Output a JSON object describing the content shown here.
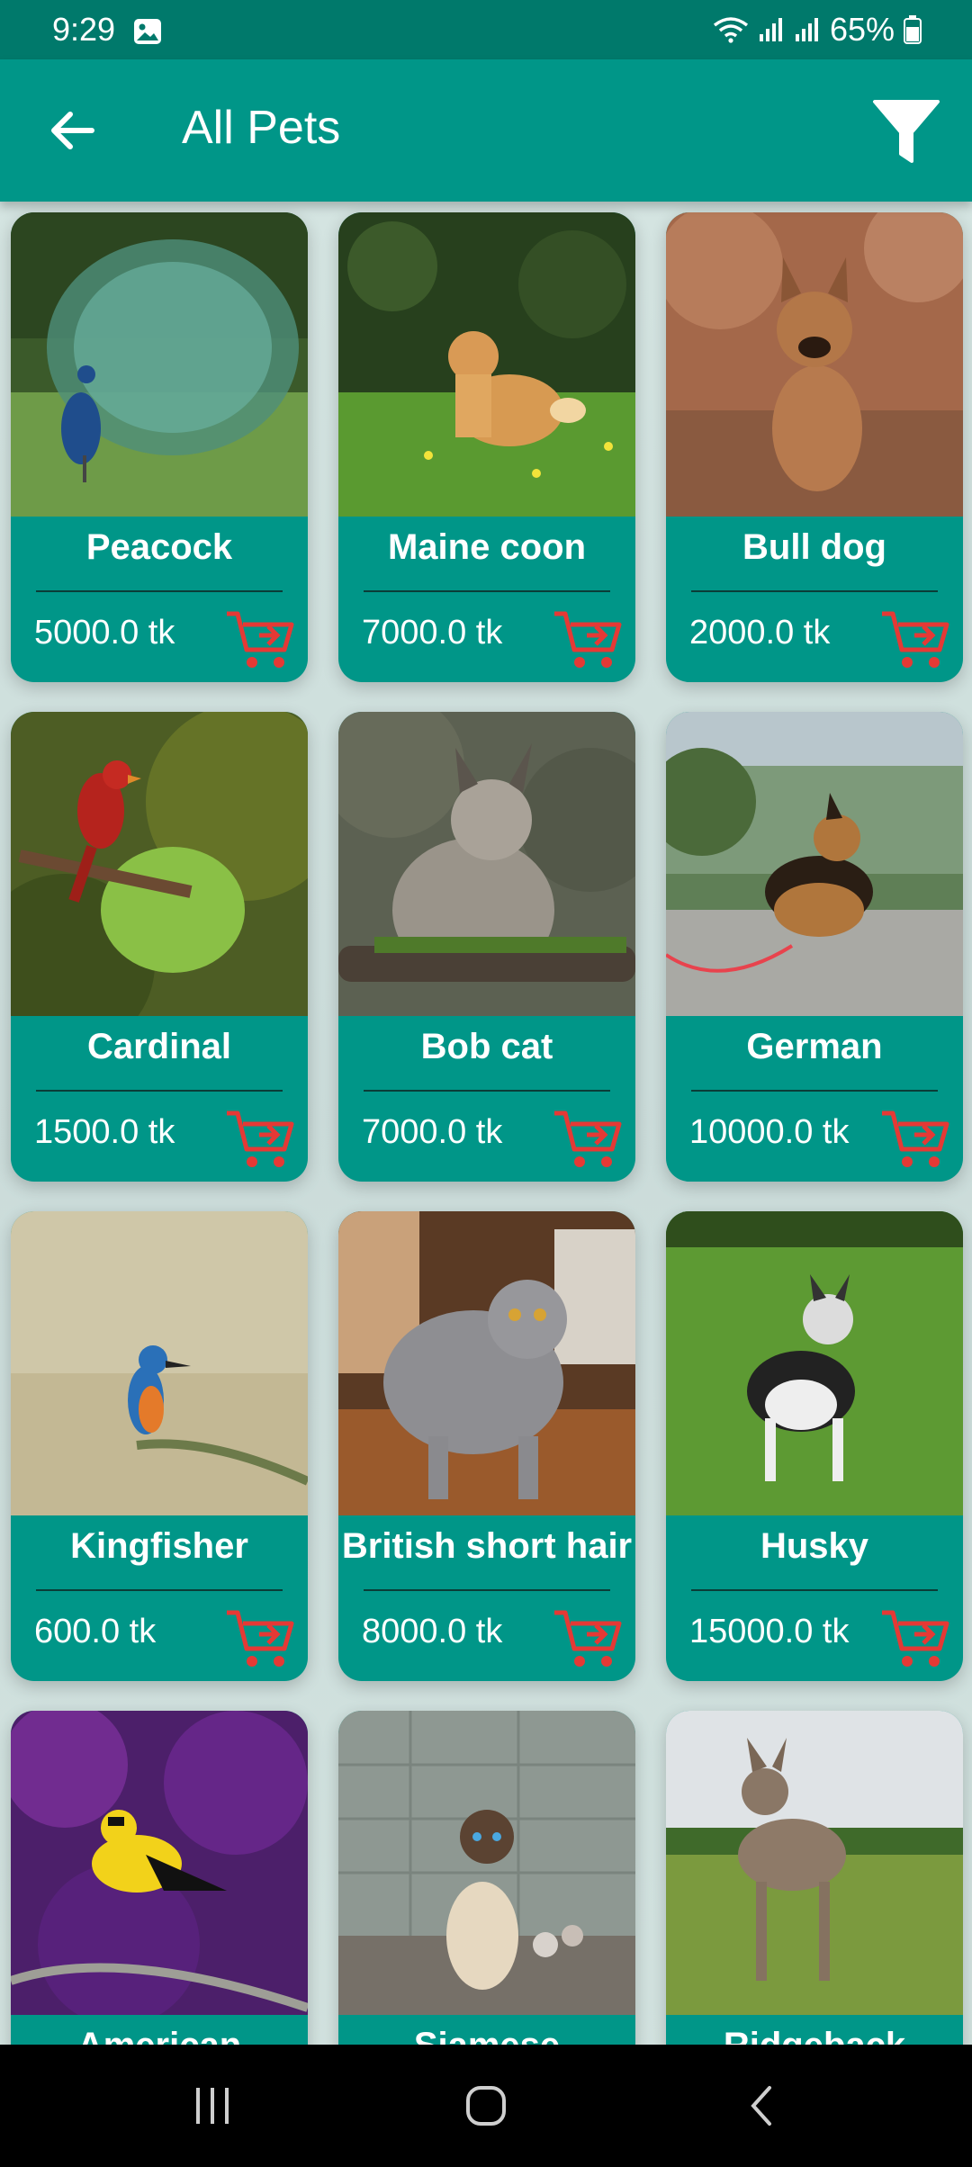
{
  "status_bar": {
    "time": "9:29",
    "battery": "65%"
  },
  "app_bar": {
    "title": "All Pets",
    "back_icon": "arrow-left-icon",
    "filter_icon": "filter-icon"
  },
  "pets": [
    {
      "name": "Peacock",
      "price": "5000.0 tk",
      "image": "peacock-photo"
    },
    {
      "name": "Maine coon",
      "price": "7000.0 tk",
      "image": "maine-coon-photo"
    },
    {
      "name": "Bull dog",
      "price": "2000.0 tk",
      "image": "bulldog-photo"
    },
    {
      "name": "Cardinal",
      "price": "1500.0 tk",
      "image": "cardinal-photo"
    },
    {
      "name": "Bob cat",
      "price": "7000.0 tk",
      "image": "bobcat-photo"
    },
    {
      "name": "German shepherd",
      "price": "10000.0 tk",
      "image": "german-shepherd-photo"
    },
    {
      "name": "Kingfisher",
      "price": "600.0 tk",
      "image": "kingfisher-photo"
    },
    {
      "name": "British short hair",
      "price": "8000.0 tk",
      "image": "british-shorthair-photo"
    },
    {
      "name": "Husky",
      "price": "15000.0 tk",
      "image": "husky-photo"
    },
    {
      "name": "American goldfinch",
      "price": "",
      "image": "goldfinch-photo"
    },
    {
      "name": "Siamese",
      "price": "",
      "image": "siamese-photo"
    },
    {
      "name": "Ridgeback",
      "price": "",
      "image": "ridgeback-photo"
    }
  ],
  "colors": {
    "primary": "#009688",
    "status_bar": "#00796b",
    "cart": "#e53935",
    "text": "#ffffff"
  }
}
